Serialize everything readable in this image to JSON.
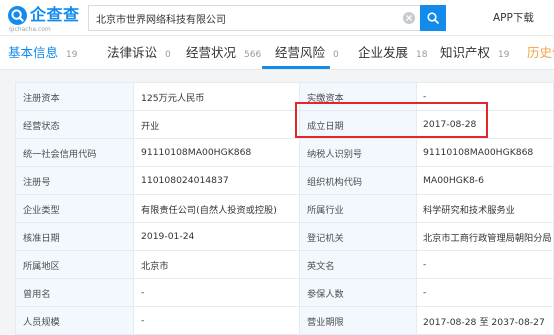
{
  "header": {
    "logo_text": "企查查",
    "logo_domain": "qichacha.com",
    "logo_icon": "qichacha-logo-icon",
    "search_value": "北京市世界网络科技有限公司",
    "clear_icon": "clear-circle-icon",
    "search_button_icon": "search-icon",
    "app_download_label": "APP下载"
  },
  "tabs": [
    {
      "label": "基本信息",
      "count": "19",
      "active": true
    },
    {
      "label": "法律诉讼",
      "count": "0"
    },
    {
      "label": "经营状况",
      "count": "566"
    },
    {
      "label": "经营风险",
      "count": "0"
    },
    {
      "label": "企业发展",
      "count": "18"
    },
    {
      "label": "知识产权",
      "count": "19"
    },
    {
      "label": "历史信"
    }
  ],
  "info_table": {
    "rows": [
      {
        "label_1": "注册资本",
        "value_1": "125万元人民币",
        "label_2": "实缴资本",
        "value_2": "-"
      },
      {
        "label_1": "经营状态",
        "value_1": "开业",
        "label_2": "成立日期",
        "value_2": "2017-08-28"
      },
      {
        "label_1": "统一社会信用代码",
        "value_1": "91110108MA00HGK868",
        "label_2": "纳税人识别号",
        "value_2": "91110108MA00HGK868"
      },
      {
        "label_1": "注册号",
        "value_1": "110108024014837",
        "label_2": "组织机构代码",
        "value_2": "MA00HGK8-6"
      },
      {
        "label_1": "企业类型",
        "value_1": "有限责任公司(自然人投资或控股)",
        "label_2": "所属行业",
        "value_2": "科学研究和技术服务业"
      },
      {
        "label_1": "核准日期",
        "value_1": "2019-01-24",
        "label_2": "登记机关",
        "value_2": "北京市工商行政管理局朝阳分局"
      },
      {
        "label_1": "所属地区",
        "value_1": "北京市",
        "label_2": "英文名",
        "value_2": "-"
      },
      {
        "label_1": "曾用名",
        "value_1": "-",
        "label_2": "参保人数",
        "value_2": "-"
      },
      {
        "label_1": "人员规模",
        "value_1": "-",
        "label_2": "营业期限",
        "value_2": "2017-08-28 至 2037-08-27"
      }
    ]
  },
  "colors": {
    "brand_blue": "#128bed",
    "highlight_red": "#e3262b",
    "history_tab_orange": "#f0a54b",
    "label_cell_bg": "#f2f8fd",
    "table_border": "#e3ebf3"
  }
}
